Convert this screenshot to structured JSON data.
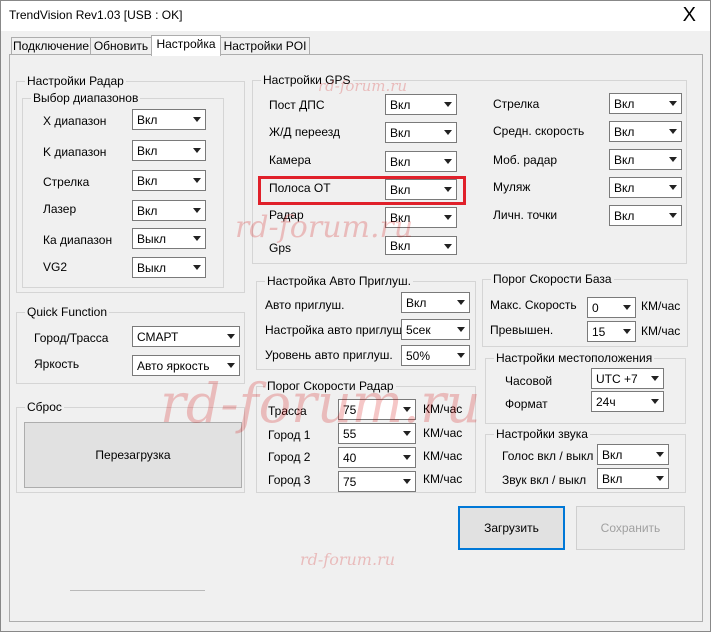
{
  "window": {
    "title": "TrendVision Rev1.03 [USB : OK]",
    "close": "X"
  },
  "tabs": [
    {
      "label": "Подключение",
      "active": false
    },
    {
      "label": "Обновить",
      "active": false
    },
    {
      "label": "Настройка",
      "active": true
    },
    {
      "label": "Настройки POI",
      "active": false
    }
  ],
  "radar": {
    "title": "Настройки Радар",
    "bands": {
      "title": "Выбор диапазонов",
      "rows": [
        {
          "label": "X диапазон",
          "value": "Вкл"
        },
        {
          "label": "K диапазон",
          "value": "Вкл"
        },
        {
          "label": "Стрелка",
          "value": "Вкл"
        },
        {
          "label": "Лазер",
          "value": "Вкл"
        },
        {
          "label": "Ка диапазон",
          "value": "Выкл"
        },
        {
          "label": "VG2",
          "value": "Выкл"
        }
      ]
    }
  },
  "quick": {
    "title": "Quick Function",
    "rows": [
      {
        "label": "Город/Трасса",
        "value": "СМАРТ"
      },
      {
        "label": "Яркость",
        "value": "Авто яркость"
      }
    ]
  },
  "reset": {
    "title": "Сброс",
    "button": "Перезагрузка"
  },
  "gps": {
    "title": "Настройки GPS",
    "left": [
      {
        "label": "Пост ДПС",
        "value": "Вкл"
      },
      {
        "label": "Ж/Д переезд",
        "value": "Вкл"
      },
      {
        "label": "Камера",
        "value": "Вкл"
      },
      {
        "label": "Полоса ОТ",
        "value": "Вкл"
      },
      {
        "label": "Радар",
        "value": "Вкл"
      },
      {
        "label": "Gps",
        "value": "Вкл"
      }
    ],
    "right": [
      {
        "label": "Стрелка",
        "value": "Вкл"
      },
      {
        "label": "Средн. скорость",
        "value": "Вкл"
      },
      {
        "label": "Моб. радар",
        "value": "Вкл"
      },
      {
        "label": "Муляж",
        "value": "Вкл"
      },
      {
        "label": "Личн. точки",
        "value": "Вкл"
      }
    ]
  },
  "automute": {
    "title": "Настройка Авто Приглуш.",
    "rows": [
      {
        "label": "Авто приглуш.",
        "value": "Вкл"
      },
      {
        "label": "Настройка авто приглуш.",
        "value": "5сек"
      },
      {
        "label": "Уровень авто приглуш.",
        "value": "50%"
      }
    ]
  },
  "speedradar": {
    "title": "Порог Скорости Радар",
    "unit": "КМ/час",
    "rows": [
      {
        "label": "Трасса",
        "value": "75"
      },
      {
        "label": "Город 1",
        "value": "55"
      },
      {
        "label": "Город 2",
        "value": "40"
      },
      {
        "label": "Город 3",
        "value": "75"
      }
    ]
  },
  "speedbase": {
    "title": "Порог Скорости База",
    "unit": "КМ/час",
    "rows": [
      {
        "label": "Макс. Скорость",
        "value": "0"
      },
      {
        "label": "Превышен.",
        "value": "15"
      }
    ]
  },
  "location": {
    "title": "Настройки местоположения",
    "rows": [
      {
        "label": "Часовой",
        "value": "UTC +7"
      },
      {
        "label": "Формат",
        "value": "24ч"
      }
    ]
  },
  "sound": {
    "title": "Настройки звука",
    "rows": [
      {
        "label": "Голос вкл / выкл",
        "value": "Вкл"
      },
      {
        "label": "Звук вкл / выкл",
        "value": "Вкл"
      }
    ]
  },
  "actions": {
    "load": "Загрузить",
    "save": "Сохранить"
  },
  "watermark": "rd-forum.ru",
  "colors": {
    "highlight": "#e0202a",
    "watermark": "#d20000",
    "focus": "#0078d7"
  }
}
